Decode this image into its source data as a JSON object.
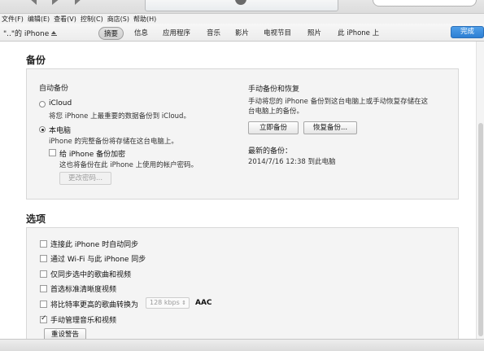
{
  "menu": [
    "文件(F)",
    "编辑(E)",
    "查看(V)",
    "控制(C)",
    "商店(S)",
    "帮助(H)"
  ],
  "device": {
    "name": "\"..\"的 iPhone"
  },
  "tabs": [
    "摘要",
    "信息",
    "应用程序",
    "音乐",
    "影片",
    "电视节目",
    "照片",
    "此 iPhone 上"
  ],
  "active_tab": "摘要",
  "done_label": "完成",
  "backup": {
    "title": "备份",
    "auto_heading": "自动备份",
    "icloud_label": "iCloud",
    "icloud_desc": "将您 iPhone 上最重要的数据备份到 iCloud。",
    "computer_label": "本电脑",
    "computer_desc": "iPhone 的完整备份将存储在这台电脑上。",
    "encrypt_label": "给 iPhone 备份加密",
    "encrypt_desc": "这也将备份在此 iPhone 上使用的帐户密码。",
    "change_password": "更改密码...",
    "manual_heading": "手动备份和恢复",
    "manual_desc_1": "手动将您的 iPhone 备份到这台电脑上或手动恢复存储在这",
    "manual_desc_2": "台电脑上的备份。",
    "backup_now": "立即备份",
    "restore_backup": "恢复备份...",
    "latest_heading": "最新的备份：",
    "latest_value": "2014/7/16  12:38 到此电脑",
    "selected": "本电脑"
  },
  "options": {
    "title": "选项",
    "items": [
      {
        "label": "连接此 iPhone 时自动同步",
        "checked": false
      },
      {
        "label": "通过 Wi-Fi 与此 iPhone 同步",
        "checked": false
      },
      {
        "label": "仅同步选中的歌曲和视频",
        "checked": false
      },
      {
        "label": "首选标准清晰度视频",
        "checked": false
      },
      {
        "label": "将比特率更高的歌曲转换为",
        "checked": false
      },
      {
        "label": "手动管理音乐和视频",
        "checked": true
      }
    ],
    "bitrate_value": "128 kbps",
    "bitrate_format": "AAC",
    "reset_warnings": "重设警告"
  }
}
